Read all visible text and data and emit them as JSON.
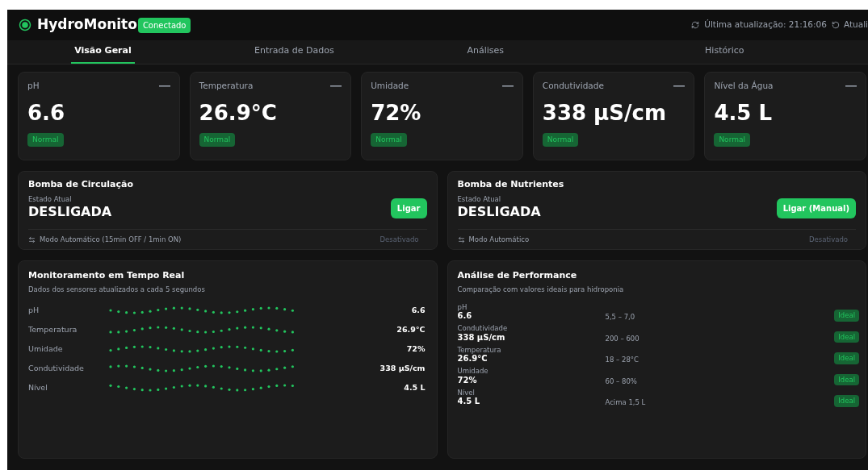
{
  "header": {
    "title": "HydroMonito",
    "connection": "Conectado",
    "last_update": "Última atualização: 21:16:06",
    "refresh": "Atuali"
  },
  "tabs": [
    {
      "label": "Visão Geral",
      "selected": true
    },
    {
      "label": "Entrada de Dados",
      "selected": false
    },
    {
      "label": "Análises",
      "selected": false
    },
    {
      "label": "Histórico",
      "selected": false
    }
  ],
  "sensors": [
    {
      "label": "pH",
      "value": "6.6",
      "status": "Normal"
    },
    {
      "label": "Temperatura",
      "value": "26.9°C",
      "status": "Normal"
    },
    {
      "label": "Umidade",
      "value": "72%",
      "status": "Normal"
    },
    {
      "label": "Condutividade",
      "value": "338 µS/cm",
      "status": "Normal"
    },
    {
      "label": "Nível da Água",
      "value": "4.5 L",
      "status": "Normal"
    }
  ],
  "pumps": [
    {
      "title": "Bomba de Circulação",
      "state_label": "Estado Atual",
      "state": "DESLIGADA",
      "button": "Ligar",
      "auto_label": "Modo Automático (15min OFF / 1min ON)",
      "auto_status": "Desativado"
    },
    {
      "title": "Bomba de Nutrientes",
      "state_label": "Estado Atual",
      "state": "DESLIGADA",
      "button": "Ligar (Manual)",
      "auto_label": "Modo Automático",
      "auto_status": "Desativado"
    }
  ],
  "realtime": {
    "title": "Monitoramento em Tempo Real",
    "subtitle": "Dados dos sensores atualizados a cada 5 segundos",
    "rows": [
      {
        "label": "pH",
        "value": "6.6"
      },
      {
        "label": "Temperatura",
        "value": "26.9°C"
      },
      {
        "label": "Umidade",
        "value": "72%"
      },
      {
        "label": "Condutividade",
        "value": "338 µS/cm"
      },
      {
        "label": "Nível",
        "value": "4.5 L"
      }
    ]
  },
  "performance": {
    "title": "Análise de Performance",
    "subtitle": "Comparação com valores ideais para hidroponia",
    "rows": [
      {
        "label": "pH",
        "value": "6.6",
        "range": "5,5 – 7,0",
        "status": "Ideal"
      },
      {
        "label": "Condutividade",
        "value": "338 µS/cm",
        "range": "200 – 600",
        "status": "Ideal"
      },
      {
        "label": "Temperatura",
        "value": "26.9°C",
        "range": "18 – 28°C",
        "status": "Ideal"
      },
      {
        "label": "Umidade",
        "value": "72%",
        "range": "60 – 80%",
        "status": "Ideal"
      },
      {
        "label": "Nível",
        "value": "4.5 L",
        "range": "Acima 1,5 L",
        "status": "Ideal"
      }
    ]
  }
}
